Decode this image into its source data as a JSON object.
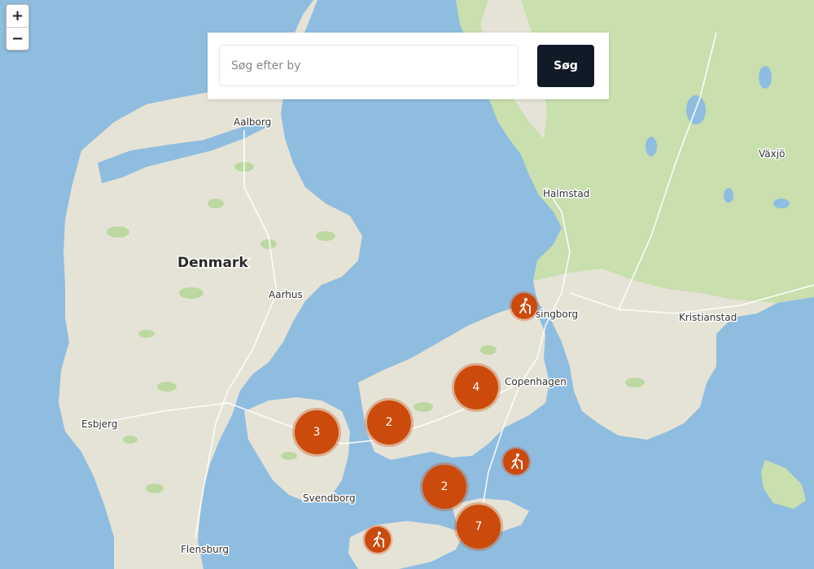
{
  "zoom": {
    "in_label": "+",
    "out_label": "−"
  },
  "search": {
    "placeholder": "Søg efter by",
    "value": "",
    "button_label": "Søg"
  },
  "labels": {
    "country": "Denmark",
    "cities": [
      "Aalborg",
      "Aarhus",
      "Esbjerg",
      "Svendborg",
      "Flensburg",
      "Copenhagen",
      "singborg",
      "Halmstad",
      "Växjö",
      "Kristianstad"
    ]
  },
  "clusters": [
    {
      "count": "4"
    },
    {
      "count": "2"
    },
    {
      "count": "3"
    },
    {
      "count": "2"
    },
    {
      "count": "7"
    }
  ],
  "hike_markers": [
    "hiker-icon",
    "hiker-icon",
    "hiker-icon"
  ],
  "colors": {
    "water": "#8fbde0",
    "land": "#e5e3d6",
    "forest": "#bcd8a0",
    "marker": "#cc4a0c",
    "button": "#111a27"
  }
}
